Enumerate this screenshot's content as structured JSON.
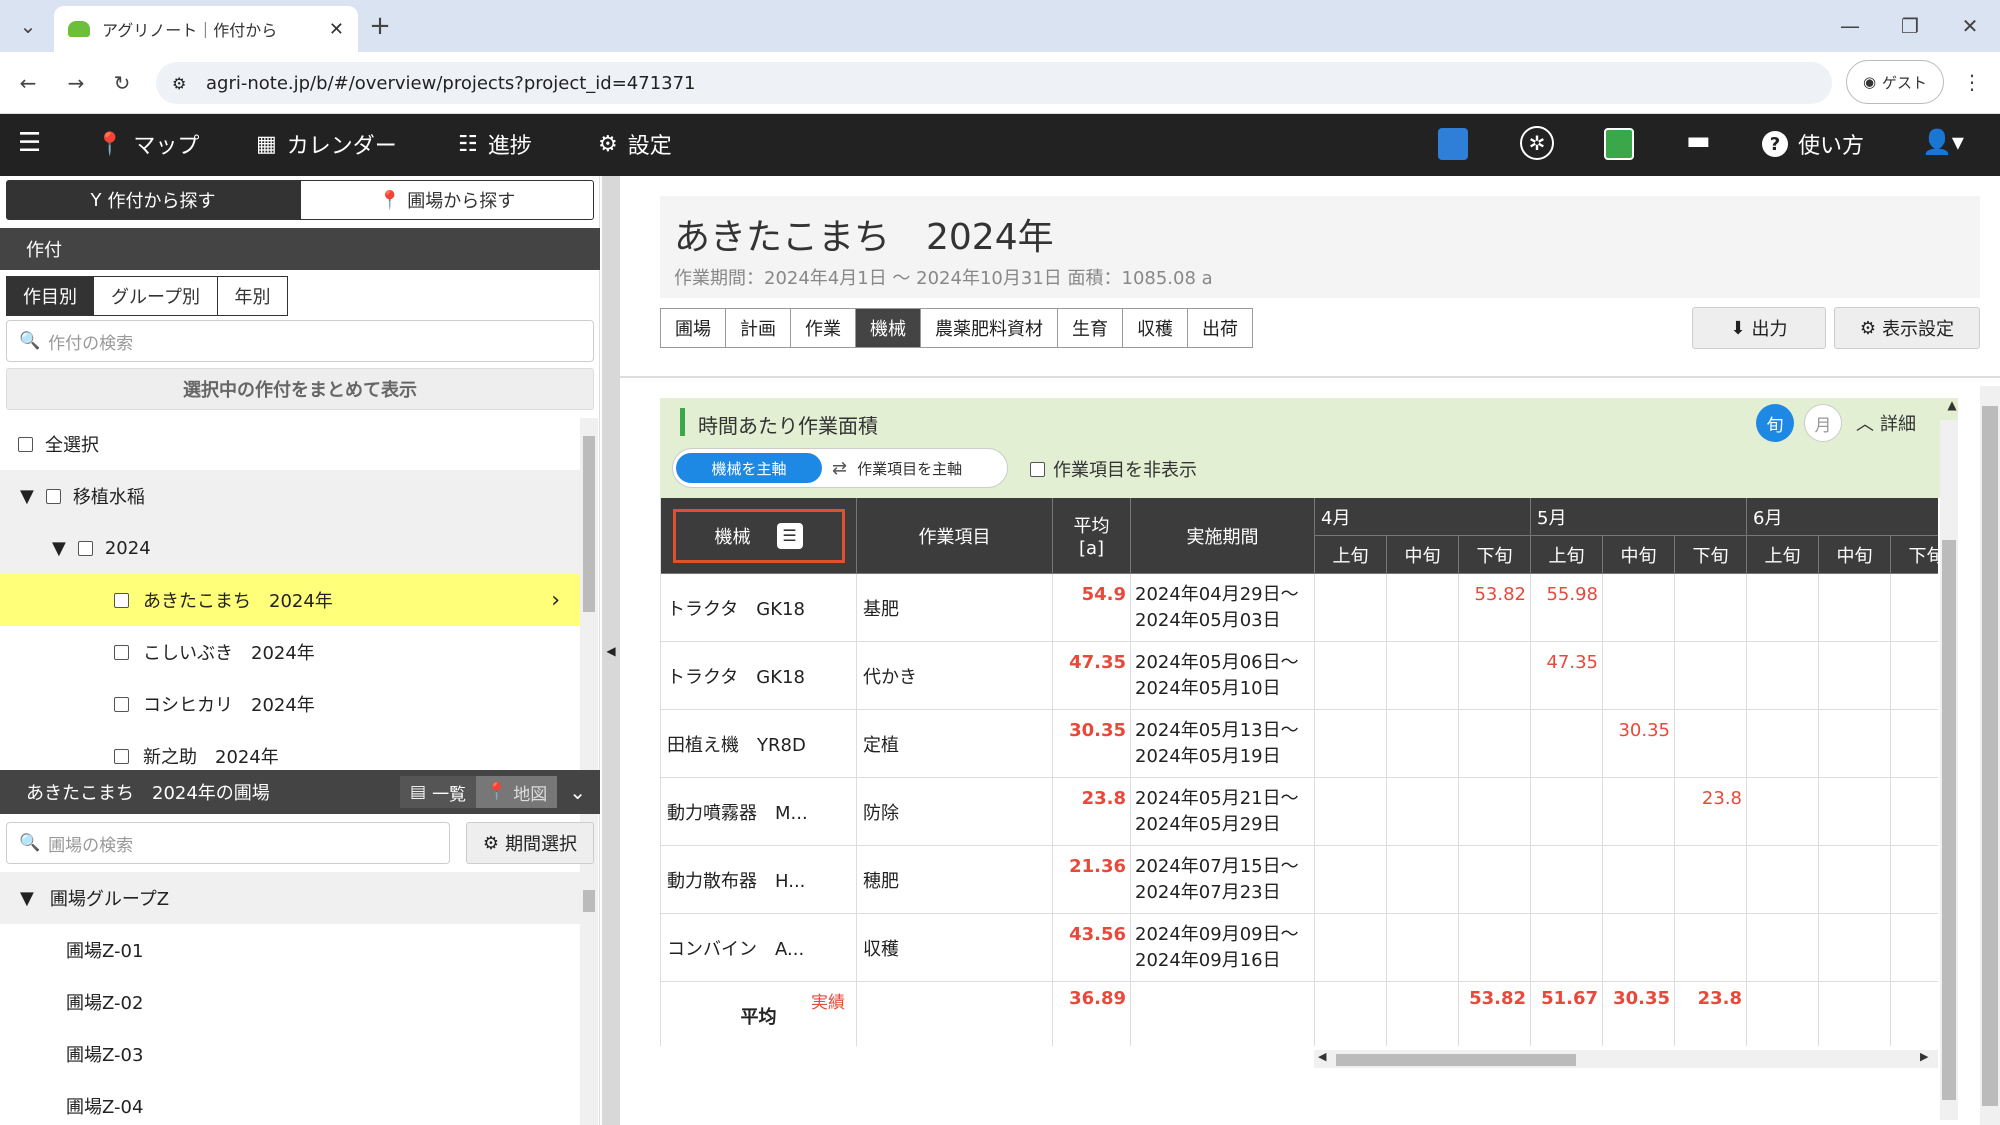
{
  "browser": {
    "tab_title": "アグリノート｜作付から",
    "url": "agri-note.jp/b/#/overview/projects?project_id=471371",
    "profile": "ゲスト"
  },
  "nav": {
    "items": [
      "マップ",
      "カレンダー",
      "進捗",
      "設定"
    ],
    "help": "使い方"
  },
  "left": {
    "search_mode": [
      "作付から探す",
      "圃場から探す"
    ],
    "section_title": "作付",
    "filters": [
      "作目別",
      "グループ別",
      "年別"
    ],
    "search_placeholder": "作付の検索",
    "bulk_button": "選択中の作付をまとめて表示",
    "select_all": "全選択",
    "group": "移植水稲",
    "year": "2024",
    "crops": [
      "あきたこまち　2024年",
      "こしいぶき　2024年",
      "コシヒカリ　2024年",
      "新之助　2024年"
    ],
    "fields_title": "あきたこまち　2024年の圃場",
    "view_list": "一覧",
    "view_map": "地図",
    "field_search_placeholder": "圃場の検索",
    "period_button": "期間選択",
    "field_group": "圃場グループZ",
    "fields": [
      "圃場Z-01",
      "圃場Z-02",
      "圃場Z-03",
      "圃場Z-04"
    ]
  },
  "main": {
    "title": "あきたこまち　2024年",
    "subtitle": "作業期間：2024年4月1日 ～ 2024年10月31日  面積：1085.08 a",
    "tabs": [
      "圃場",
      "計画",
      "作業",
      "機械",
      "農薬肥料資材",
      "生育",
      "収穫",
      "出荷"
    ],
    "active_tab": "機械",
    "export": "出力",
    "display_settings": "表示設定",
    "panel_title": "時間あたり作業面積",
    "toggle_jun": "旬",
    "toggle_month": "月",
    "detail": "詳細",
    "axis_machine": "機械を主軸",
    "axis_work": "作業項目を主軸",
    "hide_work": "作業項目を非表示",
    "headers": {
      "machine": "機械",
      "work": "作業項目",
      "avg": "平均",
      "avg_unit": "[a]",
      "period": "実施期間",
      "months": [
        "4月",
        "5月",
        "6月"
      ],
      "decades": [
        "上旬",
        "中旬",
        "下旬"
      ]
    },
    "rows": [
      {
        "machine": "トラクタ　GK18",
        "work": "基肥",
        "avg": "54.9",
        "p1": "2024年04月29日～",
        "p2": "2024年05月03日",
        "vals": [
          "",
          "",
          "53.82",
          "55.98",
          "",
          "",
          "",
          "",
          ""
        ]
      },
      {
        "machine": "トラクタ　GK18",
        "work": "代かき",
        "avg": "47.35",
        "p1": "2024年05月06日～",
        "p2": "2024年05月10日",
        "vals": [
          "",
          "",
          "",
          "47.35",
          "",
          "",
          "",
          "",
          ""
        ]
      },
      {
        "machine": "田植え機　YR8D",
        "work": "定植",
        "avg": "30.35",
        "p1": "2024年05月13日～",
        "p2": "2024年05月19日",
        "vals": [
          "",
          "",
          "",
          "",
          "30.35",
          "",
          "",
          "",
          ""
        ]
      },
      {
        "machine": "動力噴霧器　M...",
        "work": "防除",
        "avg": "23.8",
        "p1": "2024年05月21日～",
        "p2": "2024年05月29日",
        "vals": [
          "",
          "",
          "",
          "",
          "",
          "23.8",
          "",
          "",
          ""
        ]
      },
      {
        "machine": "動力散布器　H...",
        "work": "穂肥",
        "avg": "21.36",
        "p1": "2024年07月15日～",
        "p2": "2024年07月23日",
        "vals": [
          "",
          "",
          "",
          "",
          "",
          "",
          "",
          "",
          ""
        ]
      },
      {
        "machine": "コンバイン　A...",
        "work": "収穫",
        "avg": "43.56",
        "p1": "2024年09月09日～",
        "p2": "2024年09月16日",
        "vals": [
          "",
          "",
          "",
          "",
          "",
          "",
          "",
          "",
          ""
        ]
      }
    ],
    "footer": {
      "label": "平均",
      "tag": "実績",
      "avg": "36.89",
      "vals": [
        "",
        "",
        "53.82",
        "51.67",
        "30.35",
        "23.8",
        "",
        "",
        ""
      ]
    }
  }
}
